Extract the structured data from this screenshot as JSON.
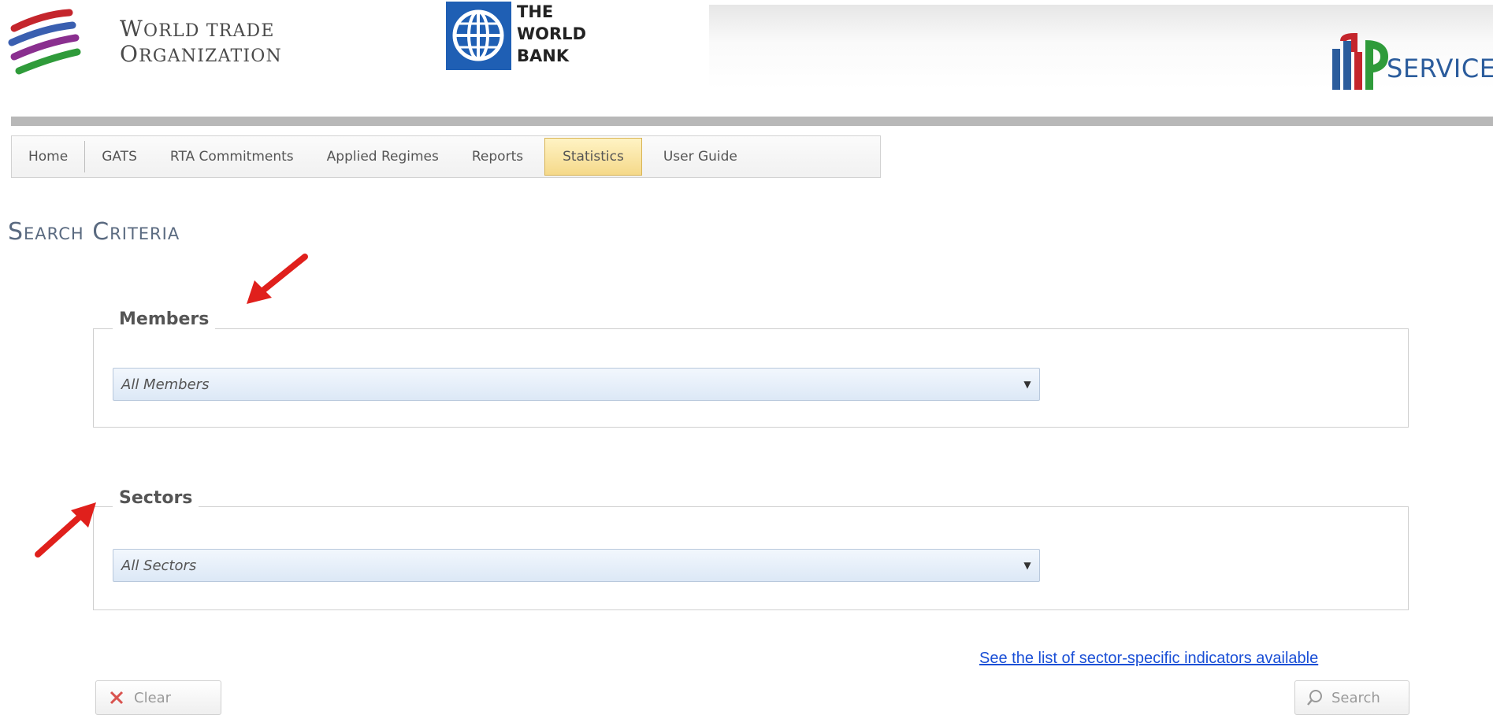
{
  "header": {
    "wto": {
      "line1_initial": "W",
      "line1_rest": "ORLD TRADE",
      "line2_initial": "O",
      "line2_rest": "RGANIZATION"
    },
    "worldbank": {
      "line1": "THE",
      "line2": "WORLD",
      "line3": "BANK"
    },
    "itip": {
      "logo_text": "SERVICES"
    }
  },
  "nav": {
    "items": [
      {
        "label": "Home"
      },
      {
        "label": "GATS"
      },
      {
        "label": "RTA Commitments"
      },
      {
        "label": "Applied Regimes"
      },
      {
        "label": "Reports"
      },
      {
        "label": "Statistics",
        "active": true
      },
      {
        "label": "User Guide"
      }
    ]
  },
  "page": {
    "title": "Search Criteria"
  },
  "members": {
    "legend": "Members",
    "selected": "All Members"
  },
  "sectors": {
    "legend": "Sectors",
    "selected": "All Sectors"
  },
  "link": {
    "sector_indicators": "See the list of sector-specific indicators available"
  },
  "buttons": {
    "clear": "Clear",
    "search": "Search"
  },
  "icons": {
    "clear": "x-icon",
    "search": "magnifier-icon",
    "dropdown": "chevron-down-icon",
    "annotation": "red-arrow-icon"
  },
  "colors": {
    "accent_link": "#1a4fd6",
    "active_tab": "#f5d98a",
    "annotation": "#e0201c",
    "header_rule": "#b8b8b8",
    "title": "#5a6a80"
  }
}
